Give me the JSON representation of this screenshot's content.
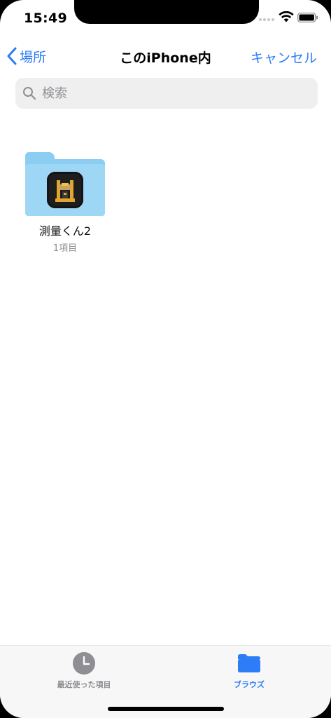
{
  "status_bar": {
    "time": "15:49"
  },
  "nav": {
    "back_label": "場所",
    "title": "このiPhone内",
    "cancel_label": "キャンセル"
  },
  "search": {
    "placeholder": "検索",
    "value": ""
  },
  "items": [
    {
      "name": "測量くん2",
      "count": "1項目",
      "icon": "folder-icon",
      "app_icon": "surveying-instrument-icon"
    }
  ],
  "tab_bar": {
    "recent_label": "最近使った項目",
    "browse_label": "ブラウズ",
    "active_tab": "browse"
  },
  "colors": {
    "accent": "#2e7cf6",
    "folder": "#9ed6f5",
    "placeholder": "#8e8e93"
  }
}
